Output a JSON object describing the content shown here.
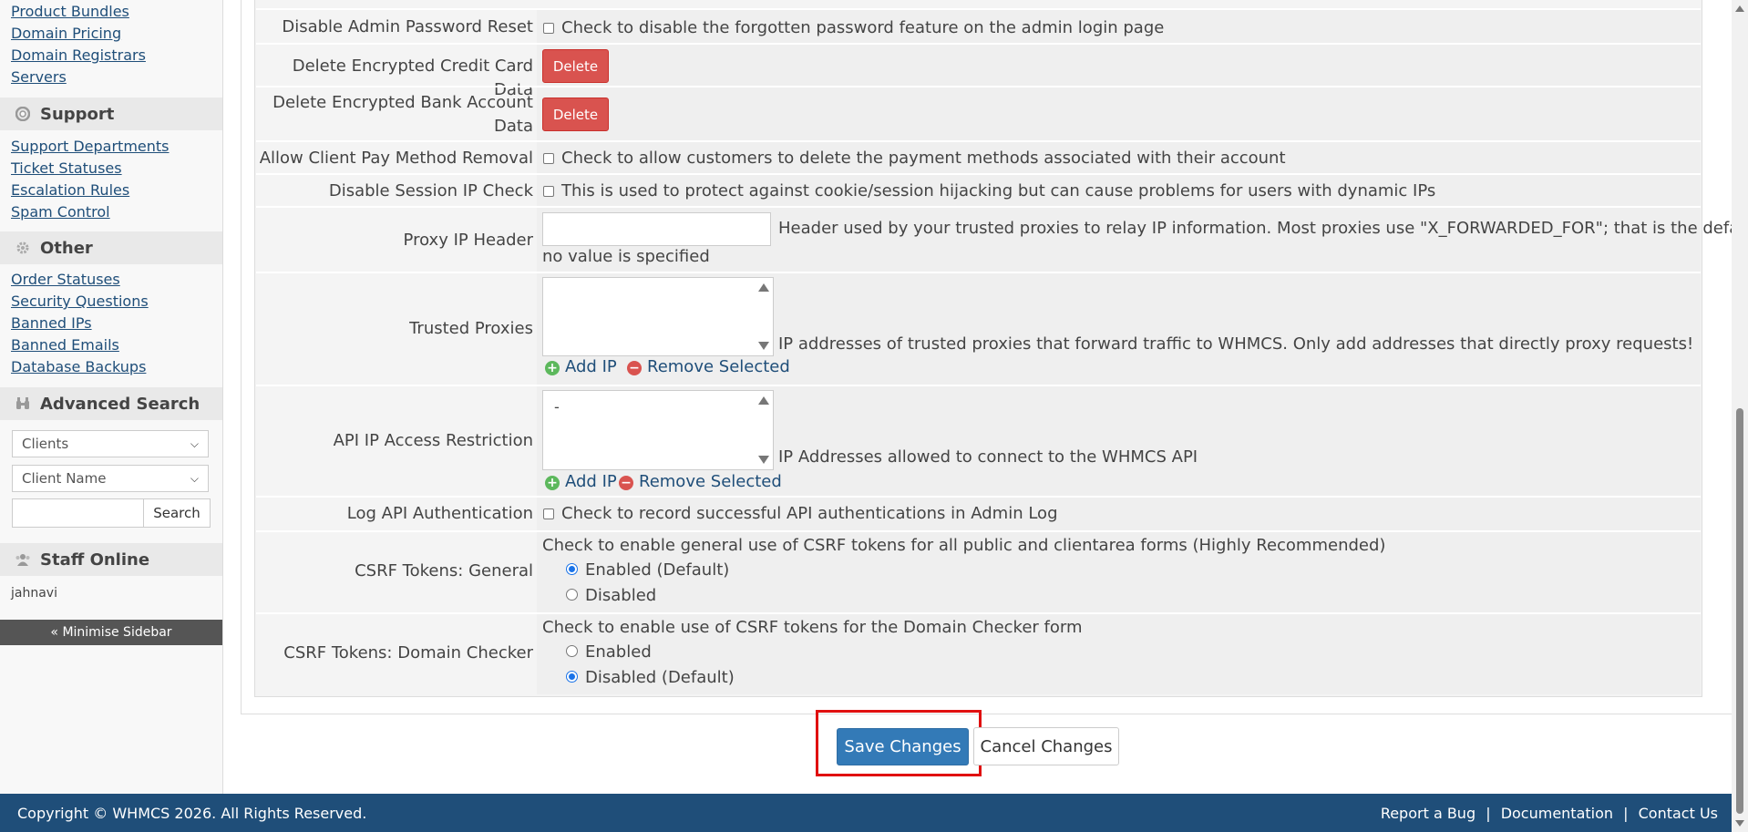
{
  "sidebar": {
    "links_top": [
      "Product Bundles",
      "Domain Pricing",
      "Domain Registrars",
      "Servers"
    ],
    "support": {
      "title": "Support",
      "items": [
        "Support Departments",
        "Ticket Statuses",
        "Escalation Rules",
        "Spam Control"
      ]
    },
    "other": {
      "title": "Other",
      "items": [
        "Order Statuses",
        "Security Questions",
        "Banned IPs",
        "Banned Emails",
        "Database Backups"
      ]
    },
    "advanced_search": {
      "title": "Advanced Search",
      "select_type": "Clients",
      "select_field": "Client Name",
      "search_value": "",
      "search_button": "Search"
    },
    "staff_online": {
      "title": "Staff Online",
      "user": "jahnavi"
    },
    "minimise": "« Minimise Sidebar"
  },
  "settings": {
    "disable_admin_pw_reset": {
      "label": "Disable Admin Password Reset",
      "desc": "Check to disable the forgotten password feature on the admin login page",
      "checked": false
    },
    "delete_cc": {
      "label": "Delete Encrypted Credit Card Data",
      "button": "Delete"
    },
    "delete_bank": {
      "label_line1": "Delete Encrypted Bank Account",
      "label_line2": "Data",
      "button": "Delete"
    },
    "allow_pay_removal": {
      "label": "Allow Client Pay Method Removal",
      "desc": "Check to allow customers to delete the payment methods associated with their account",
      "checked": false
    },
    "disable_session_ip": {
      "label": "Disable Session IP Check",
      "desc": "This is used to protect against cookie/session hijacking but can cause problems for users with dynamic IPs",
      "checked": false
    },
    "proxy_ip_header": {
      "label": "Proxy IP Header",
      "value": "",
      "desc_line1": "Header used by your trusted proxies to relay IP information. Most proxies use \"X_FORWARDED_FOR\"; that is the default if",
      "desc_line2": "no value is specified"
    },
    "trusted_proxies": {
      "label": "Trusted Proxies",
      "desc": "IP addresses of trusted proxies that forward traffic to WHMCS. Only add addresses that directly proxy requests!",
      "add": "Add IP",
      "remove": "Remove Selected"
    },
    "api_ip_restriction": {
      "label": "API IP Access Restriction",
      "list_item": "-",
      "desc": "IP Addresses allowed to connect to the WHMCS API",
      "add": "Add IP",
      "remove": "Remove Selected"
    },
    "log_api_auth": {
      "label": "Log API Authentication",
      "desc": "Check to record successful API authentications in Admin Log",
      "checked": false
    },
    "csrf_general": {
      "label": "CSRF Tokens: General",
      "desc": "Check to enable general use of CSRF tokens for all public and clientarea forms (Highly Recommended)",
      "option1": "Enabled (Default)",
      "option2": "Disabled",
      "selected": "option1"
    },
    "csrf_domain": {
      "label": "CSRF Tokens: Domain Checker",
      "desc": "Check to enable use of CSRF tokens for the Domain Checker form",
      "option1": "Enabled",
      "option2": "Disabled (Default)",
      "selected": "option2"
    }
  },
  "actions": {
    "save": "Save Changes",
    "cancel": "Cancel Changes"
  },
  "footer": {
    "copyright": "Copyright © WHMCS 2026. All Rights Reserved.",
    "report_bug": "Report a Bug",
    "documentation": "Documentation",
    "contact": "Contact Us",
    "separator": "|"
  },
  "colors": {
    "footer_bg": "#1f4e79",
    "save_button": "#337ab7",
    "delete_button": "#d9534f",
    "highlight": "#e01010"
  }
}
